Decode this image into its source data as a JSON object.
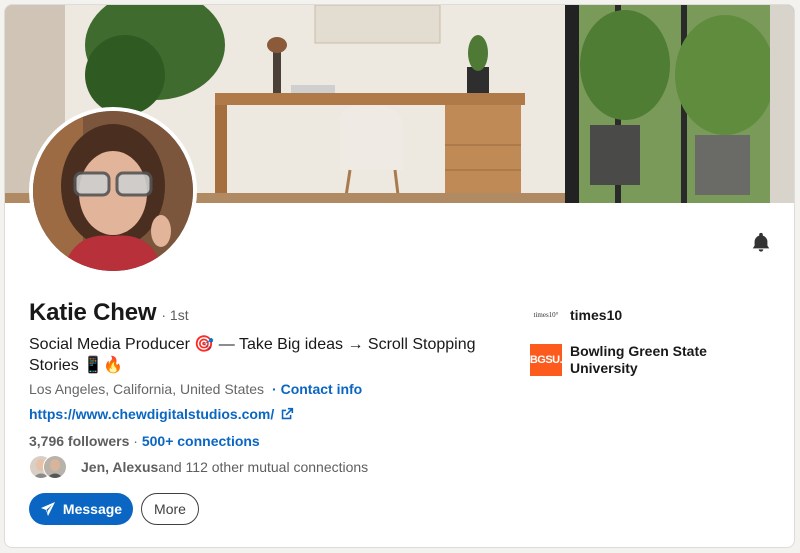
{
  "profile": {
    "name": "Katie Chew",
    "degree": "· 1st",
    "headline": "Social Media Producer 🎯 — Take Big ideas → Scroll Stopping Stories 📱🔥",
    "location": "Los Angeles, California, United States",
    "contact_info": "· Contact info",
    "website": "https://www.chewdigitalstudios.com/",
    "followers": "3,796 followers",
    "stats_separator": " · ",
    "connections": "500+ connections",
    "mutual_names": "Jen, Alexus",
    "mutual_rest": " and 112 other mutual connections"
  },
  "actions": {
    "message_label": "Message",
    "more_label": "More"
  },
  "organizations": [
    {
      "logo_text": "times10°",
      "name": "times10"
    },
    {
      "logo_text": "BGSU.",
      "name": "Bowling Green State University"
    }
  ],
  "icons": {
    "notify": "bell-icon",
    "website": "external-link-icon",
    "message": "send-icon"
  },
  "colors": {
    "link": "#0a66c2",
    "primary_button": "#0a66c2",
    "bgsu_orange": "#fd5a1e"
  }
}
